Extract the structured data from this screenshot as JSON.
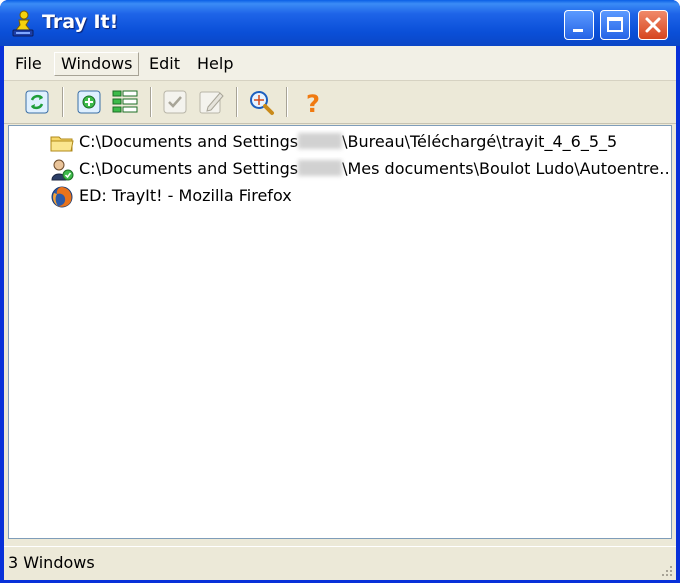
{
  "window": {
    "title": "Tray It!"
  },
  "menu": [
    {
      "label": "File"
    },
    {
      "label": "Windows"
    },
    {
      "label": "Edit"
    },
    {
      "label": "Help"
    }
  ],
  "toolbar": {
    "buttons": [
      {
        "icon": "refresh-icon"
      },
      {
        "icon": "add-window-icon"
      },
      {
        "icon": "list-view-icon"
      },
      {
        "icon": "check-icon",
        "disabled": true
      },
      {
        "icon": "edit-icon",
        "disabled": true
      },
      {
        "icon": "find-window-icon"
      },
      {
        "icon": "help-icon"
      }
    ]
  },
  "list": {
    "items": [
      {
        "icon": "folder-icon",
        "prefix": "C:\\Documents and Settings",
        "suffix": "\\Bureau\\Téléchargé\\trayit_4_6_5_5"
      },
      {
        "icon": "user-folder-icon",
        "prefix": "C:\\Documents and Settings",
        "suffix": "\\Mes documents\\Boulot Ludo\\Autoentre…"
      },
      {
        "icon": "firefox-icon",
        "prefix": "ED: TrayIt! - Mozilla Firefox",
        "suffix": ""
      }
    ]
  },
  "status": {
    "text": "3 Windows"
  },
  "colors": {
    "titlebar": "#0a4fd8",
    "accent": "#0831d9",
    "close": "#d6451f"
  }
}
